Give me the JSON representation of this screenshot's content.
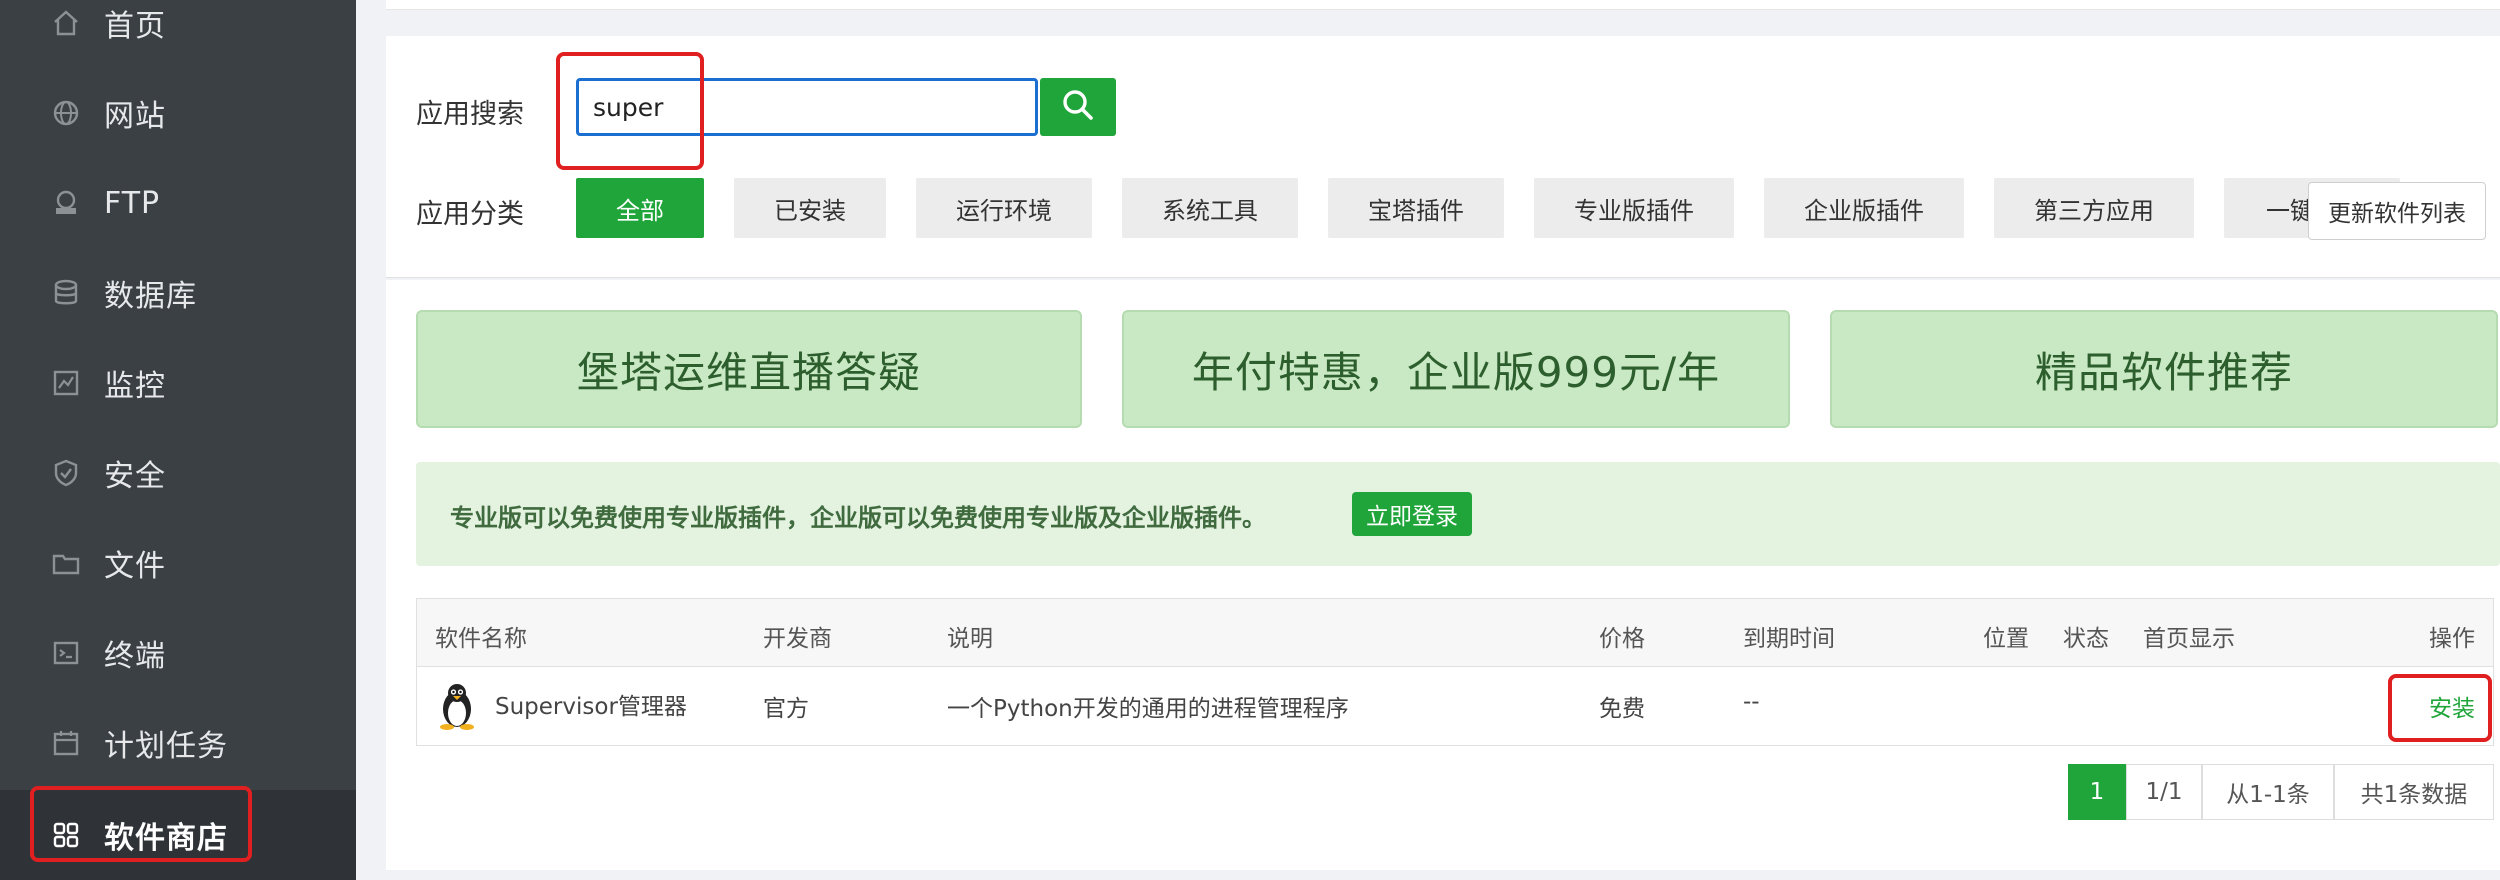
{
  "sidebar": {
    "items": [
      {
        "label": "首页",
        "icon": "home-icon"
      },
      {
        "label": "网站",
        "icon": "globe-icon"
      },
      {
        "label": "FTP",
        "icon": "ftp-icon"
      },
      {
        "label": "数据库",
        "icon": "database-icon"
      },
      {
        "label": "监控",
        "icon": "monitor-icon"
      },
      {
        "label": "安全",
        "icon": "shield-icon"
      },
      {
        "label": "文件",
        "icon": "folder-icon"
      },
      {
        "label": "终端",
        "icon": "terminal-icon"
      },
      {
        "label": "计划任务",
        "icon": "calendar-icon"
      },
      {
        "label": "软件商店",
        "icon": "grid-icon"
      }
    ],
    "active_index": 9
  },
  "search": {
    "label": "应用搜索",
    "value": "super",
    "button_icon": "search-icon"
  },
  "categories": {
    "label": "应用分类",
    "items": [
      "全部",
      "已安装",
      "运行环境",
      "系统工具",
      "宝塔插件",
      "专业版插件",
      "企业版插件",
      "第三方应用",
      "一键"
    ],
    "active_index": 0,
    "refresh_label": "更新软件列表"
  },
  "banners": [
    "堡塔运维直播答疑",
    "年付特惠，企业版999元/年",
    "精品软件推荐"
  ],
  "notice": {
    "text": "专业版可以免费使用专业版插件，企业版可以免费使用专业版及企业版插件。",
    "button": "立即登录"
  },
  "table": {
    "headers": [
      "软件名称",
      "开发商",
      "说明",
      "价格",
      "到期时间",
      "位置",
      "状态",
      "首页显示",
      "操作"
    ],
    "rows": [
      {
        "name": "Supervisor管理器",
        "developer": "官方",
        "description": "一个Python开发的通用的进程管理程序",
        "price": "免费",
        "expiry": "--",
        "action": "安装",
        "icon": "penguin-icon"
      }
    ]
  },
  "pagination": {
    "current": "1",
    "pages": "1/1",
    "range": "从1-1条",
    "total": "共1条数据"
  },
  "colors": {
    "accent": "#20a53a",
    "sidebar_bg": "#3b4045",
    "highlight": "#e02020",
    "input_border": "#1a6fd1"
  }
}
